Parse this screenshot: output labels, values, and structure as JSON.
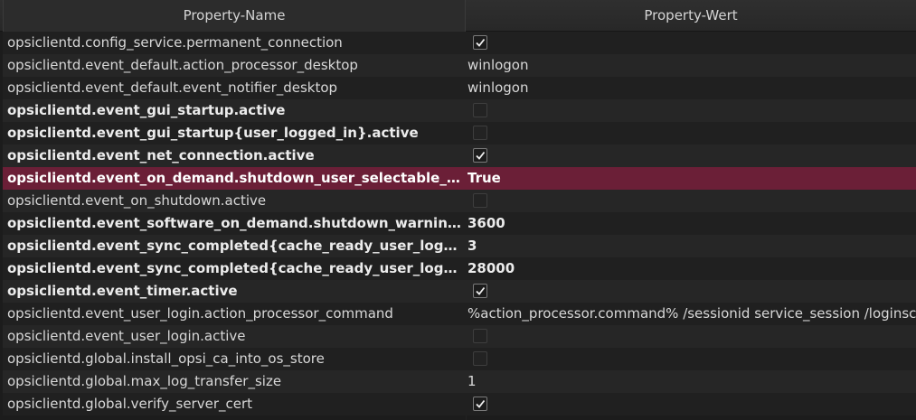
{
  "table": {
    "columns": {
      "name": "Property-Name",
      "value": "Property-Wert"
    },
    "rows": [
      {
        "name": "opsiclientd.config_service.permanent_connection",
        "type": "bool",
        "checked": true,
        "value": "",
        "bold": false
      },
      {
        "name": "opsiclientd.event_default.action_processor_desktop",
        "type": "text",
        "checked": false,
        "value": "winlogon",
        "bold": false
      },
      {
        "name": "opsiclientd.event_default.event_notifier_desktop",
        "type": "text",
        "checked": false,
        "value": "winlogon",
        "bold": false
      },
      {
        "name": "opsiclientd.event_gui_startup.active",
        "type": "bool",
        "checked": false,
        "value": "",
        "bold": true
      },
      {
        "name": "opsiclientd.event_gui_startup{user_logged_in}.active",
        "type": "bool",
        "checked": false,
        "value": "",
        "bold": true
      },
      {
        "name": "opsiclientd.event_net_connection.active",
        "type": "bool",
        "checked": true,
        "value": "",
        "bold": true
      },
      {
        "name": "opsiclientd.event_on_demand.shutdown_user_selectable_time",
        "type": "text",
        "checked": false,
        "value": "True",
        "bold": true,
        "selected": true
      },
      {
        "name": "opsiclientd.event_on_shutdown.active",
        "type": "bool",
        "checked": false,
        "value": "",
        "bold": false
      },
      {
        "name": "opsiclientd.event_software_on_demand.shutdown_warning_ti...",
        "type": "text",
        "checked": false,
        "value": "3600",
        "bold": true
      },
      {
        "name": "opsiclientd.event_sync_completed{cache_ready_user_logged...",
        "type": "text",
        "checked": false,
        "value": "3",
        "bold": true
      },
      {
        "name": "opsiclientd.event_sync_completed{cache_ready_user_logged...",
        "type": "text",
        "checked": false,
        "value": "28000",
        "bold": true
      },
      {
        "name": "opsiclientd.event_timer.active",
        "type": "bool",
        "checked": true,
        "value": "",
        "bold": true
      },
      {
        "name": "opsiclientd.event_user_login.action_processor_command",
        "type": "text",
        "checked": false,
        "value": "%action_processor.command% /sessionid service_session /loginscripts",
        "bold": false
      },
      {
        "name": "opsiclientd.event_user_login.active",
        "type": "bool",
        "checked": false,
        "value": "",
        "bold": false
      },
      {
        "name": "opsiclientd.global.install_opsi_ca_into_os_store",
        "type": "bool",
        "checked": false,
        "value": "",
        "bold": false
      },
      {
        "name": "opsiclientd.global.max_log_transfer_size",
        "type": "text",
        "checked": false,
        "value": "1",
        "bold": false
      },
      {
        "name": "opsiclientd.global.verify_server_cert",
        "type": "bool",
        "checked": true,
        "value": "",
        "bold": false
      }
    ]
  },
  "colors": {
    "background": "#1c1c1c",
    "selected_row": "#6b1f37",
    "header": "#2c2c2c"
  }
}
